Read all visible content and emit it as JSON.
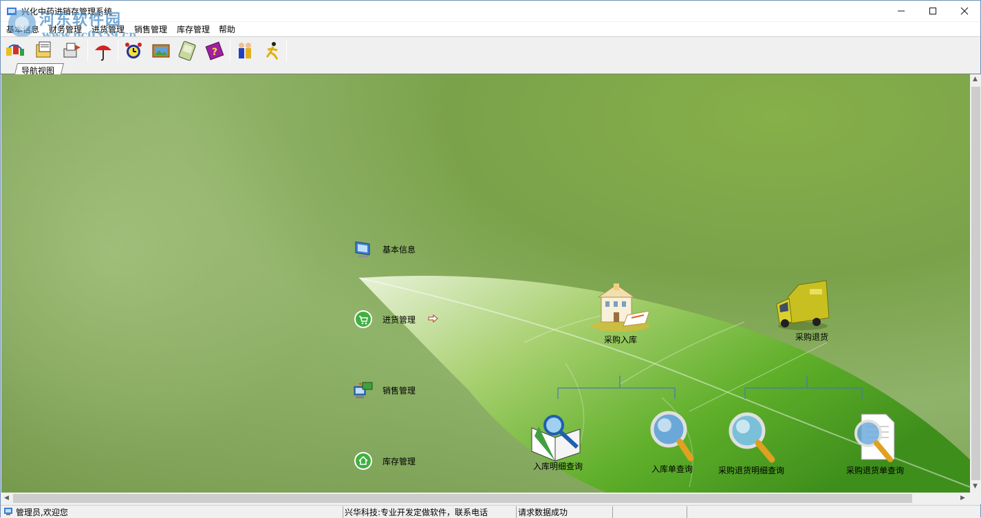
{
  "window": {
    "title": "兴化中药进销存管理系统"
  },
  "watermark": {
    "line1": "河东软件园",
    "line2": "www.pc0359.cn"
  },
  "menu": {
    "items": [
      "基本信息",
      "财务管理",
      "进货管理",
      "销售管理",
      "库存管理",
      "帮助"
    ]
  },
  "toolbar": {
    "icons": [
      "database-connect-icon",
      "folder-docs-icon",
      "print-transfer-icon",
      "umbrella-icon",
      "alarm-clock-icon",
      "picture-frame-icon",
      "notepad-icon",
      "help-book-icon",
      "users-icon",
      "exit-runner-icon"
    ]
  },
  "tabs": {
    "active": "导航视图"
  },
  "nav": {
    "items": [
      {
        "label": "基本信息",
        "icon": "computer-icon"
      },
      {
        "label": "进货管理",
        "icon": "cart-icon"
      },
      {
        "label": "销售管理",
        "icon": "network-icon"
      },
      {
        "label": "库存管理",
        "icon": "home-icon"
      }
    ]
  },
  "purchase": {
    "top": [
      {
        "label": "采购入库",
        "icon": "warehouse-building-icon"
      },
      {
        "label": "采购退货",
        "icon": "delivery-truck-icon"
      }
    ],
    "bottom": [
      {
        "label": "入库明细查询",
        "icon": "book-magnifier-icon"
      },
      {
        "label": "入库单查询",
        "icon": "magnifier-icon"
      },
      {
        "label": "采购退货明细查询",
        "icon": "magnifier-icon"
      },
      {
        "label": "采购退货单查询",
        "icon": "document-magnifier-icon"
      }
    ]
  },
  "status": {
    "user": "管理员,欢迎您",
    "company": "兴华科技:专业开发定做软件，联系电话",
    "message": "请求数据成功"
  },
  "colors": {
    "canvas": "#7fa650",
    "leaf": "#5fae2a",
    "connector": "#4a78b0"
  }
}
